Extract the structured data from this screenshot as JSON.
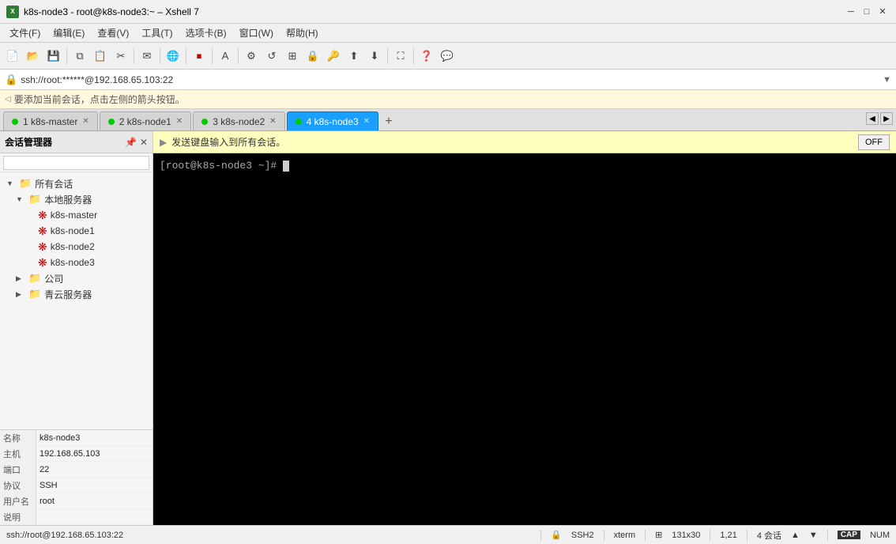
{
  "window": {
    "title": "k8s-node3 - root@k8s-node3:~ – Xshell 7",
    "app_icon": "X"
  },
  "menu": {
    "items": [
      {
        "label": "文件(F)"
      },
      {
        "label": "编辑(E)"
      },
      {
        "label": "查看(V)"
      },
      {
        "label": "工具(T)"
      },
      {
        "label": "选项卡(B)"
      },
      {
        "label": "窗口(W)"
      },
      {
        "label": "帮助(H)"
      }
    ]
  },
  "address_bar": {
    "url": "ssh://root:******@192.168.65.103:22",
    "hint": "要添加当前会话，点击左侧的箭头按钮。"
  },
  "broadcast_bar": {
    "text": "发送键盘输入到所有会话。",
    "off_label": "OFF"
  },
  "tabs": [
    {
      "id": 1,
      "label": "1 k8s-master",
      "active": false
    },
    {
      "id": 2,
      "label": "2 k8s-node1",
      "active": false
    },
    {
      "id": 3,
      "label": "3 k8s-node2",
      "active": false
    },
    {
      "id": 4,
      "label": "4 k8s-node3",
      "active": true
    }
  ],
  "sidebar": {
    "title": "会话管理器",
    "tree": [
      {
        "level": 0,
        "type": "folder",
        "label": "所有会话",
        "expanded": true
      },
      {
        "level": 1,
        "type": "folder",
        "label": "本地服务器",
        "expanded": true
      },
      {
        "level": 2,
        "type": "server",
        "label": "k8s-master"
      },
      {
        "level": 2,
        "type": "server",
        "label": "k8s-node1"
      },
      {
        "level": 2,
        "type": "server",
        "label": "k8s-node2"
      },
      {
        "level": 2,
        "type": "server",
        "label": "k8s-node3"
      },
      {
        "level": 1,
        "type": "folder",
        "label": "公司",
        "expanded": false
      },
      {
        "level": 1,
        "type": "folder",
        "label": "青云服务器",
        "expanded": false
      }
    ]
  },
  "properties": [
    {
      "label": "名称",
      "value": "k8s-node3"
    },
    {
      "label": "主机",
      "value": "192.168.65.103"
    },
    {
      "label": "端口",
      "value": "22"
    },
    {
      "label": "协议",
      "value": "SSH"
    },
    {
      "label": "用户名",
      "value": "root"
    },
    {
      "label": "说明",
      "value": ""
    }
  ],
  "terminal": {
    "prompt": "[root@k8s-node3 ~]# "
  },
  "status_bar": {
    "left": "ssh://root@192.168.65.103:22",
    "ssh": "SSH2",
    "term": "xterm",
    "size": "131x30",
    "cursor": "1,21",
    "sessions": "4 会话",
    "up_arrow": "▲",
    "down_arrow": "▼",
    "cap": "CAP",
    "num": "NUM"
  }
}
